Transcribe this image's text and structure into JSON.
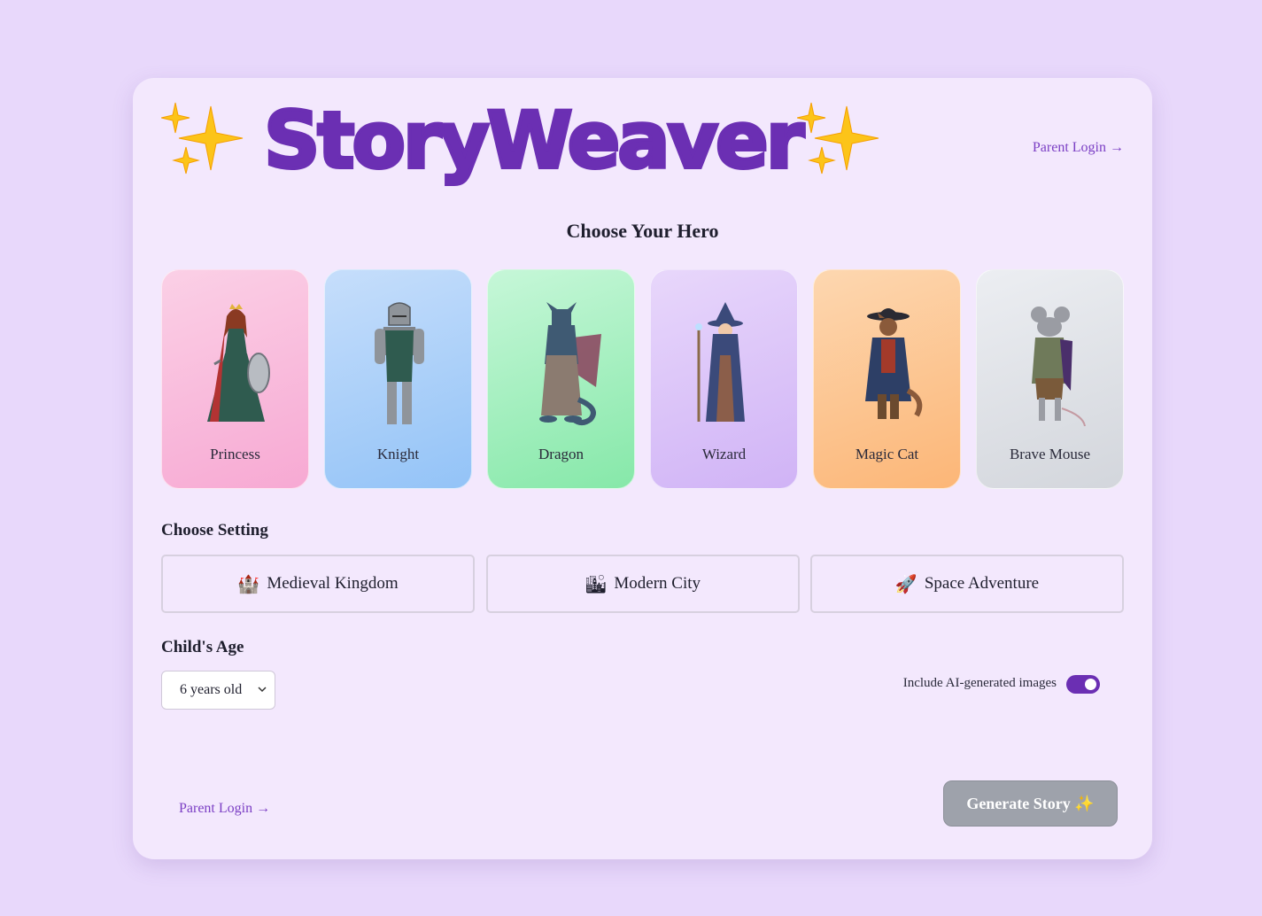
{
  "app": {
    "title": "StoryWeaver",
    "parent_login_top": "Parent Login →",
    "parent_login_bottom": "Parent Login →"
  },
  "hero_section": {
    "title": "Choose Your Hero",
    "heroes": [
      {
        "label": "Princess",
        "icon": "princess-icon"
      },
      {
        "label": "Knight",
        "icon": "knight-icon"
      },
      {
        "label": "Dragon",
        "icon": "dragon-icon"
      },
      {
        "label": "Wizard",
        "icon": "wizard-icon"
      },
      {
        "label": "Magic Cat",
        "icon": "magic-cat-icon"
      },
      {
        "label": "Brave Mouse",
        "icon": "brave-mouse-icon"
      }
    ]
  },
  "setting_section": {
    "title": "Choose Setting",
    "options": [
      {
        "label": "Medieval Kingdom",
        "emoji": "🏰"
      },
      {
        "label": "Modern City",
        "emoji": "🏙"
      },
      {
        "label": "Space Adventure",
        "emoji": "🚀"
      }
    ]
  },
  "age_section": {
    "title": "Child's Age",
    "selected": "6 years old"
  },
  "images_toggle": {
    "label": "Include AI-generated images",
    "enabled": true
  },
  "generate_button": {
    "label": "Generate Story ✨"
  },
  "colors": {
    "background": "#e8d8fb",
    "card": "#f3e8fd",
    "brand_purple": "#6b2fb3",
    "link_purple": "#7b3fc4",
    "button_disabled": "#9ea2ab",
    "sparkle": "#fcc419"
  }
}
